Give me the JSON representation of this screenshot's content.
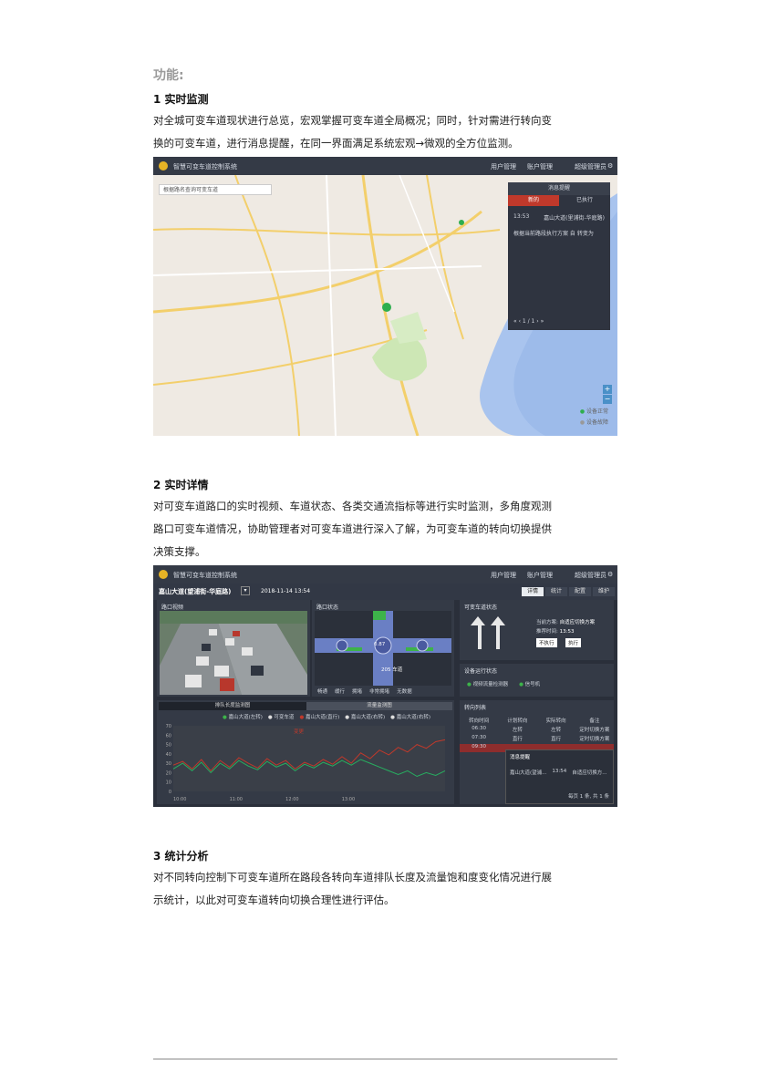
{
  "heading": "功能:",
  "section1": {
    "title": "1 实时监测",
    "lines": [
      "对全城可变车道现状进行总览，宏观掌握可变车道全局概况；同时，针对需进行转向变",
      "换的可变车道，进行消息提醒，在同一界面满足系统宏观→微观的全方位监测。"
    ]
  },
  "screenshot1": {
    "app_title": "智慧可变车道控制系统",
    "nav": [
      "用户管理",
      "账户管理",
      "超级管理员"
    ],
    "search_placeholder": "根据路名查询可变车道",
    "panel": {
      "header": "消息提醒",
      "tabs": [
        "新的",
        "已执行"
      ],
      "time": "13:53",
      "location": "嘉山大道(里浦街-华庭路)",
      "message": "根据当前路段执行方案 自 转变为",
      "pager": "« ‹ 1 / 1 › »"
    },
    "legend": [
      "设备正常",
      "设备故障"
    ]
  },
  "section2": {
    "title": "2 实时详情",
    "lines": [
      "对可变车道路口的实时视频、车道状态、各类交通流指标等进行实时监测，多角度观测",
      "路口可变车道情况，协助管理者对可变车道进行深入了解，为可变车道的转向切换提供",
      "决策支撑。"
    ]
  },
  "screenshot2": {
    "app_title": "智慧可变车道控制系统",
    "nav": [
      "用户管理",
      "账户管理",
      "超级管理员"
    ],
    "road": "嘉山大道(望浦街-华庭路)",
    "datetime": "2018-11-14 13:54",
    "tabs": [
      "详情",
      "统计",
      "配置",
      "维护"
    ],
    "panes": {
      "video": "路口视频",
      "status": "路口状态",
      "lane": "可变车道状态",
      "device": "设备运行状态",
      "table": "转向列表"
    },
    "status_value": "0.87",
    "status_lane": "205 车道",
    "lane_info": {
      "k1": "当前方案:",
      "v1": "自适应切换方案",
      "k2": "推荐时间:",
      "v2": "13:53",
      "btn1": "不执行",
      "btn2": "执行"
    },
    "device_items": [
      "视频流量检测器",
      "信号机"
    ],
    "chart_tabs": [
      "排队长度监测图",
      "流量监测图"
    ],
    "chart_legend": [
      "嘉山大道(左转)",
      "可变车道",
      "嘉山大道(直行)",
      "嘉山大道(右转)",
      "嘉山大道(右转)"
    ],
    "chart_mark": "变更",
    "table_headers": [
      "转向时间",
      "计划转向",
      "实际转向",
      "备注"
    ],
    "table_rows": [
      [
        "06:30",
        "左转",
        "左转",
        "定时切换方案"
      ],
      [
        "07:30",
        "直行",
        "直行",
        "定时切换方案"
      ],
      [
        "09:30",
        "",
        "",
        ""
      ]
    ],
    "popup": {
      "title": "消息提醒",
      "loc": "嘉山大道(望浦...",
      "time": "13:54",
      "msg": "自适应切换方...",
      "pager": "每页 1 条, 共 1 条"
    },
    "status_legend": [
      "畅通",
      "缓行",
      "拥堵",
      "非常拥堵",
      "无数据"
    ]
  },
  "chart_data": {
    "type": "line",
    "x": [
      "10:00",
      "11:00",
      "12:00",
      "13:00"
    ],
    "ylim": [
      0,
      70
    ],
    "yticks": [
      0,
      10,
      20,
      30,
      40,
      50,
      60,
      70
    ],
    "series": [
      {
        "name": "嘉山大道(左转)",
        "color": "#c0392b",
        "values": [
          28,
          32,
          24,
          34,
          22,
          33,
          26,
          36,
          30,
          25,
          35,
          28,
          33,
          24,
          31,
          27,
          34,
          29,
          37,
          30,
          41,
          35,
          44,
          39,
          47,
          42,
          50,
          46,
          53,
          55
        ]
      },
      {
        "name": "可变车道",
        "color": "#27ae60",
        "values": [
          24,
          30,
          22,
          31,
          20,
          30,
          24,
          33,
          27,
          23,
          32,
          26,
          30,
          22,
          29,
          25,
          31,
          27,
          33,
          28,
          34,
          30,
          26,
          22,
          18,
          22,
          16,
          20,
          17,
          22
        ]
      }
    ]
  },
  "section3": {
    "title": "3 统计分析",
    "lines": [
      "对不同转向控制下可变车道所在路段各转向车道排队长度及流量饱和度变化情况进行展",
      "示统计，以此对可变车道转向切换合理性进行评估。"
    ]
  }
}
